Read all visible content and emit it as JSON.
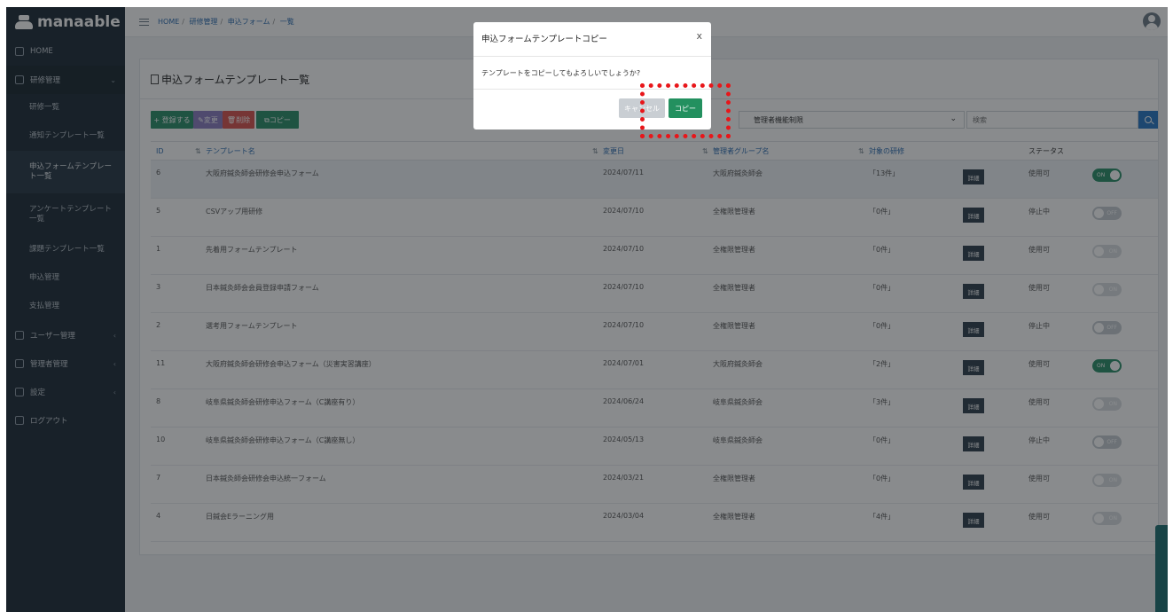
{
  "app": {
    "logo": "manaable"
  },
  "sidebar": {
    "items": [
      {
        "label": "HOME"
      },
      {
        "label": "研修管理",
        "sub": [
          "研修一覧",
          "通知テンプレート一覧",
          "申込フォームテンプレート一覧",
          "アンケートテンプレート一覧",
          "課題テンプレート一覧",
          "申込管理",
          "支払管理"
        ]
      },
      {
        "label": "ユーザー管理"
      },
      {
        "label": "管理者管理"
      },
      {
        "label": "設定"
      },
      {
        "label": "ログアウト"
      }
    ]
  },
  "breadcrumb": {
    "home": "HOME",
    "level1": "研修管理",
    "level2": "申込フォーム",
    "level3": "一覧"
  },
  "page": {
    "title": "申込フォームテンプレート一覧"
  },
  "toolbar": {
    "register": "+ 登録する",
    "edit": "✎変更",
    "delete": "🗑削除",
    "copy": "⧉コピー",
    "filter_value": "管理者機能制限",
    "search_placeholder": "検索"
  },
  "table": {
    "headers": {
      "id": "ID",
      "name": "テンプレート名",
      "updated": "変更日",
      "group": "管理者グループ名",
      "count": "対象の研修",
      "status": "ステータス"
    },
    "detail_label": "詳細",
    "rows": [
      {
        "id": "6",
        "name": "大阪府鍼灸師会研修会申込フォーム",
        "updated": "2024/07/11",
        "group": "大阪府鍼灸師会",
        "count": "「13件」",
        "status": "使用可",
        "toggle": "ON"
      },
      {
        "id": "5",
        "name": "CSVアップ用研修",
        "updated": "2024/07/10",
        "group": "全権限管理者",
        "count": "「0件」",
        "status": "停止中",
        "toggle": "OFF"
      },
      {
        "id": "1",
        "name": "先着用フォームテンプレート",
        "updated": "2024/07/10",
        "group": "全権限管理者",
        "count": "「0件」",
        "status": "使用可",
        "toggle": "ON"
      },
      {
        "id": "3",
        "name": "日本鍼灸師会会員登録申請フォーム",
        "updated": "2024/07/10",
        "group": "全権限管理者",
        "count": "「0件」",
        "status": "使用可",
        "toggle": "ON"
      },
      {
        "id": "2",
        "name": "選考用フォームテンプレート",
        "updated": "2024/07/10",
        "group": "全権限管理者",
        "count": "「0件」",
        "status": "停止中",
        "toggle": "OFF"
      },
      {
        "id": "11",
        "name": "大阪府鍼灸師会研修会申込フォーム（災害実習講座）",
        "updated": "2024/07/01",
        "group": "大阪府鍼灸師会",
        "count": "「2件」",
        "status": "使用可",
        "toggle": "ON"
      },
      {
        "id": "8",
        "name": "岐阜県鍼灸師会研修申込フォーム（C講座有り）",
        "updated": "2024/06/24",
        "group": "岐阜県鍼灸師会",
        "count": "「3件」",
        "status": "使用可",
        "toggle": "ON"
      },
      {
        "id": "10",
        "name": "岐阜県鍼灸師会研修申込フォーム（C講座無し）",
        "updated": "2024/05/13",
        "group": "岐阜県鍼灸師会",
        "count": "「0件」",
        "status": "停止中",
        "toggle": "OFF"
      },
      {
        "id": "7",
        "name": "日本鍼灸師会研修会申込統一フォーム",
        "updated": "2024/03/21",
        "group": "全権限管理者",
        "count": "「0件」",
        "status": "使用可",
        "toggle": "ON"
      },
      {
        "id": "4",
        "name": "日鍼会Eラーニング用",
        "updated": "2024/03/04",
        "group": "全権限管理者",
        "count": "「4件」",
        "status": "使用可",
        "toggle": "ON"
      }
    ]
  },
  "modal": {
    "title": "申込フォームテンプレートコピー",
    "close": "x",
    "body": "テンプレートをコピーしてもよろしいでしょうか?",
    "cancel": "キャンセル",
    "confirm": "コピー"
  }
}
